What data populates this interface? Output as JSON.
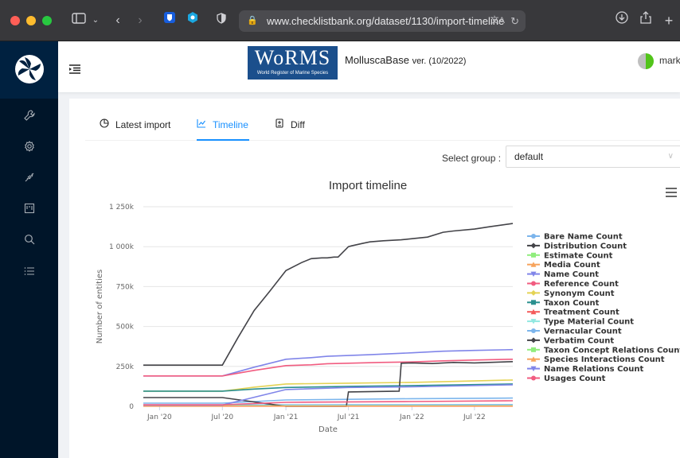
{
  "browser": {
    "url": "www.checklistbank.org/dataset/1130/import-timeline"
  },
  "header": {
    "logo_big": "WoRMS",
    "logo_small": "World Register of Marine Species",
    "dataset_title": "MolluscaBase",
    "dataset_version": "ver. (10/2022)",
    "user_name": "mark"
  },
  "sidebar": {
    "items": [
      "wrench-icon",
      "settings-icon",
      "plug-icon",
      "project-icon",
      "search-icon",
      "list-icon"
    ]
  },
  "tabs": [
    {
      "label": "Latest import",
      "icon": "pie-chart-icon",
      "active": false
    },
    {
      "label": "Timeline",
      "icon": "line-chart-icon",
      "active": true
    },
    {
      "label": "Diff",
      "icon": "diff-icon",
      "active": false
    }
  ],
  "group": {
    "label": "Select group :",
    "value": "default"
  },
  "chart_data": {
    "type": "line",
    "title": "Import timeline",
    "xlabel": "Date",
    "ylabel": "Number of entities",
    "x_ticks": [
      "Jan '20",
      "Jul '20",
      "Jan '21",
      "Jul '21",
      "Jan '22",
      "Jul '22"
    ],
    "y_ticks": [
      "0",
      "250k",
      "500k",
      "750k",
      "1 000k",
      "1 250k"
    ],
    "ylim": [
      0,
      1250000
    ],
    "xlim": [
      "2019-11-15",
      "2022-10-20"
    ],
    "legend": "right",
    "grid": true,
    "series": [
      {
        "name": "Bare Name Count",
        "color": "#7cb5ec",
        "marker": "circle",
        "x": [
          "2019-11-15",
          "2020-07-01",
          "2021-01-01",
          "2021-07-01",
          "2022-01-01",
          "2022-10-20"
        ],
        "y": [
          8000,
          8000,
          9000,
          9500,
          10000,
          10500
        ]
      },
      {
        "name": "Distribution Count",
        "color": "#434348",
        "marker": "diamond",
        "x": [
          "2019-11-15",
          "2020-07-01",
          "2020-08-15",
          "2020-10-01",
          "2020-11-15",
          "2021-01-01",
          "2021-02-15",
          "2021-03-15",
          "2021-04-15",
          "2021-05-01",
          "2021-05-20",
          "2021-06-01",
          "2021-07-01",
          "2021-07-10",
          "2021-08-10",
          "2021-09-01",
          "2021-10-10",
          "2021-12-01",
          "2022-01-01",
          "2022-02-15",
          "2022-04-01",
          "2022-05-01",
          "2022-07-01",
          "2022-08-15",
          "2022-10-20"
        ],
        "y": [
          258000,
          258000,
          430000,
          600000,
          720000,
          850000,
          900000,
          925000,
          930000,
          930000,
          935000,
          935000,
          1000000,
          1005000,
          1020000,
          1030000,
          1037000,
          1043000,
          1050000,
          1060000,
          1090000,
          1098000,
          1110000,
          1125000,
          1145000
        ]
      },
      {
        "name": "Estimate Count",
        "color": "#90ed7d",
        "marker": "square",
        "x": [
          "2019-11-15",
          "2022-10-20"
        ],
        "y": [
          3000,
          3000
        ]
      },
      {
        "name": "Media Count",
        "color": "#f7a35c",
        "marker": "triangle",
        "x": [
          "2019-11-15",
          "2022-10-20"
        ],
        "y": [
          2000,
          2000
        ]
      },
      {
        "name": "Name Count",
        "color": "#8085e9",
        "marker": "triangle-down",
        "x": [
          "2019-11-15",
          "2020-07-01",
          "2020-10-01",
          "2021-01-01",
          "2021-03-15",
          "2021-05-01",
          "2021-07-01",
          "2021-09-01",
          "2022-01-01",
          "2022-04-01",
          "2022-07-01",
          "2022-10-20"
        ],
        "y": [
          190000,
          190000,
          245000,
          295000,
          305000,
          313000,
          318000,
          323000,
          335000,
          345000,
          350000,
          355000
        ]
      },
      {
        "name": "Reference Count",
        "color": "#f15c80",
        "marker": "circle",
        "x": [
          "2019-11-15",
          "2020-07-01",
          "2020-10-01",
          "2021-01-01",
          "2021-03-15",
          "2021-05-01",
          "2021-07-01",
          "2021-10-01",
          "2022-01-01",
          "2022-04-01",
          "2022-07-01",
          "2022-10-20"
        ],
        "y": [
          190000,
          190000,
          225000,
          255000,
          260000,
          267000,
          270000,
          275000,
          278000,
          285000,
          290000,
          295000
        ]
      },
      {
        "name": "Synonym Count",
        "color": "#e4d354",
        "marker": "diamond",
        "x": [
          "2019-11-15",
          "2020-07-01",
          "2020-10-01",
          "2021-01-01",
          "2021-07-01",
          "2022-01-01",
          "2022-10-20"
        ],
        "y": [
          95000,
          95000,
          120000,
          140000,
          145000,
          150000,
          165000
        ]
      },
      {
        "name": "Taxon Count",
        "color": "#2b908f",
        "marker": "square",
        "x": [
          "2019-11-15",
          "2020-07-01",
          "2020-10-01",
          "2021-01-01",
          "2021-07-01",
          "2022-01-01",
          "2022-10-20"
        ],
        "y": [
          95000,
          95000,
          108000,
          118000,
          125000,
          130000,
          140000
        ]
      },
      {
        "name": "Treatment Count",
        "color": "#f45b5b",
        "marker": "triangle",
        "x": [
          "2019-11-15",
          "2022-10-20"
        ],
        "y": [
          1000,
          1000
        ]
      },
      {
        "name": "Type Material Count",
        "color": "#91e8e1",
        "marker": "triangle-down",
        "x": [
          "2019-11-15",
          "2022-10-20"
        ],
        "y": [
          5000,
          5000
        ]
      },
      {
        "name": "Vernacular Count",
        "color": "#7cb5ec",
        "marker": "circle",
        "x": [
          "2019-11-15",
          "2020-07-01",
          "2021-01-01",
          "2022-01-01",
          "2022-10-20"
        ],
        "y": [
          20000,
          20000,
          40000,
          48000,
          52000
        ]
      },
      {
        "name": "Verbatim Count",
        "color": "#434348",
        "marker": "diamond",
        "x": [
          "2019-11-15",
          "2020-07-01",
          "2021-01-01",
          "2021-06-25",
          "2021-07-01",
          "2021-11-25",
          "2021-12-01",
          "2022-01-01",
          "2022-03-01",
          "2022-05-01",
          "2022-07-01",
          "2022-10-20"
        ],
        "y": [
          55000,
          55000,
          0,
          0,
          90000,
          95000,
          270000,
          272000,
          268000,
          275000,
          272000,
          280000
        ]
      },
      {
        "name": "Taxon Concept Relations Count",
        "color": "#90ed7d",
        "marker": "square",
        "x": [
          "2019-11-15",
          "2022-10-20"
        ],
        "y": [
          2500,
          2500
        ]
      },
      {
        "name": "Species Interactions Count",
        "color": "#f7a35c",
        "marker": "triangle",
        "x": [
          "2019-11-15",
          "2022-10-20"
        ],
        "y": [
          1500,
          1500
        ]
      },
      {
        "name": "Name Relations Count",
        "color": "#8085e9",
        "marker": "triangle-down",
        "x": [
          "2019-11-15",
          "2020-07-01",
          "2021-01-01",
          "2021-07-01",
          "2022-01-01",
          "2022-10-20"
        ],
        "y": [
          8000,
          8000,
          105000,
          118000,
          122000,
          135000
        ]
      },
      {
        "name": "Usages Count",
        "color": "#f15c80",
        "marker": "circle",
        "x": [
          "2019-11-15",
          "2020-07-01",
          "2021-01-01",
          "2022-01-01",
          "2022-10-20"
        ],
        "y": [
          10000,
          10000,
          25000,
          30000,
          35000
        ]
      }
    ]
  }
}
